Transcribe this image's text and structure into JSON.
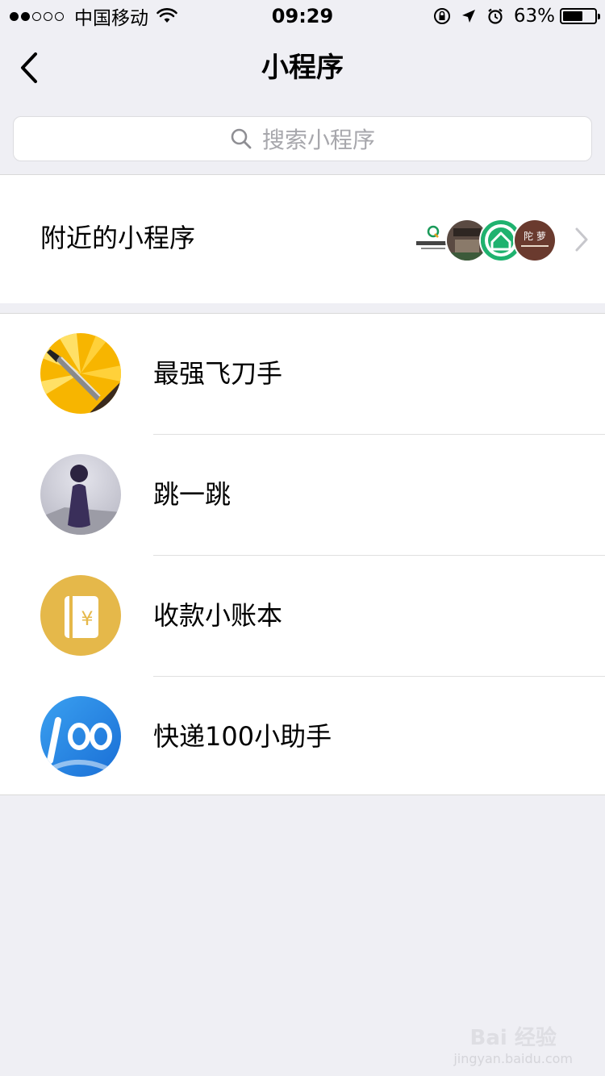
{
  "status_bar": {
    "carrier": "中国移动",
    "time": "09:29",
    "battery_percent": "63%",
    "battery_level": 0.63,
    "signal_bars": 2,
    "signal_total": 5
  },
  "nav": {
    "title": "小程序",
    "back_icon": "chevron-left-icon"
  },
  "search": {
    "placeholder": "搜索小程序",
    "icon": "search-icon"
  },
  "nearby": {
    "label": "附近的小程序",
    "thumb_text": "陀 萝"
  },
  "list": {
    "items": [
      {
        "name": "最强飞刀手",
        "icon": "flying-knife-icon"
      },
      {
        "name": "跳一跳",
        "icon": "jump-piece-icon"
      },
      {
        "name": "收款小账本",
        "icon": "ledger-yuan-icon"
      },
      {
        "name": "快递100小助手",
        "icon": "kuaidi100-icon"
      }
    ]
  },
  "watermark": {
    "main": "Bai 经验",
    "sub": "jingyan.baidu.com"
  },
  "colors": {
    "background": "#efeff4",
    "card": "#ffffff",
    "placeholder": "#a7a7ac",
    "chevron": "#c7c7cc"
  }
}
